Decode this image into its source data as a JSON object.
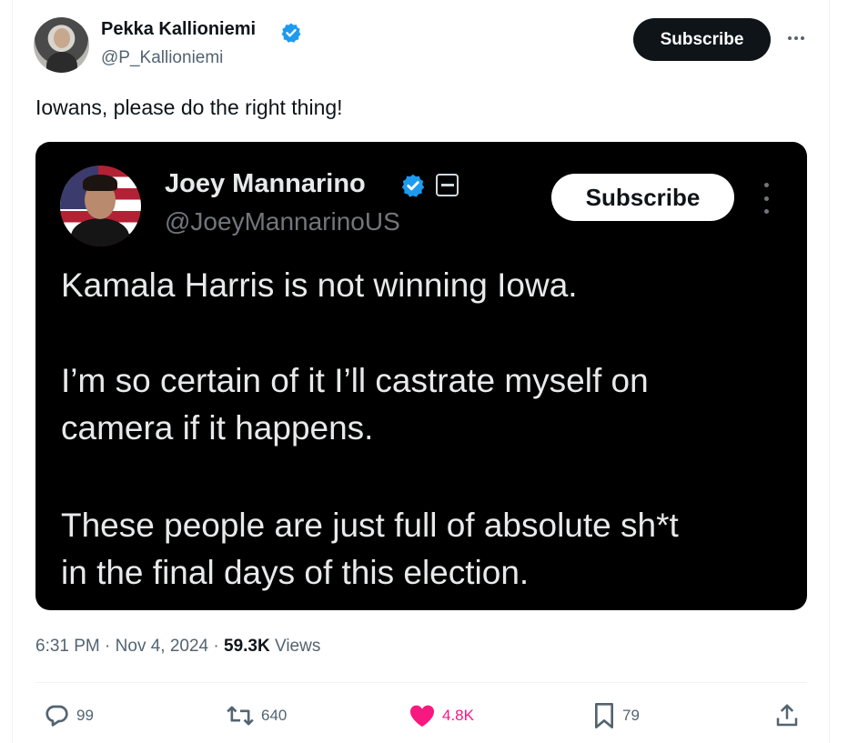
{
  "tweet": {
    "author_name": "Pekka Kallioniemi",
    "author_handle": "@P_Kallioniemi",
    "subscribe_label": "Subscribe",
    "text": "Iowans, please do the right thing!",
    "time": "6:31 PM",
    "separator_1": "·",
    "date": "Nov 4, 2024",
    "separator_2": "·",
    "views_count": "59.3K",
    "views_label": "Views"
  },
  "embedded": {
    "author_name": "Joey Mannarino",
    "author_handle": "@JoeyMannarinoUS",
    "subscribe_label": "Subscribe",
    "lines": [
      "Kamala Harris is not winning Iowa.",
      "I’m so certain of it I’ll castrate myself on",
      "camera if it happens.",
      "These people are just full of absolute sh*t",
      "in the final days of this election."
    ]
  },
  "actions": {
    "replies": "99",
    "reposts": "640",
    "likes": "4.8K",
    "bookmarks": "79"
  },
  "colors": {
    "verified_blue": "#1d9bf0",
    "like_pink": "#f91880",
    "muted": "#536471"
  }
}
